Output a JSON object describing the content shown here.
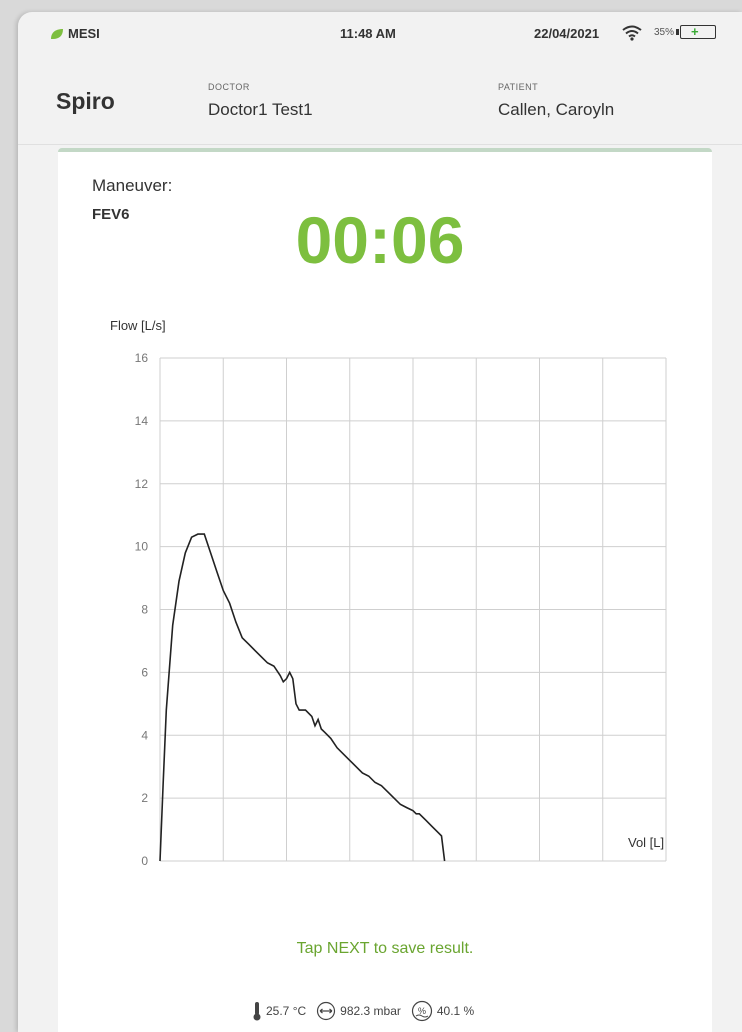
{
  "status_bar": {
    "brand": "MESI",
    "time": "11:48 AM",
    "date": "22/04/2021",
    "battery": "35%",
    "brand_color": "#7dbf3f"
  },
  "header": {
    "title": "Spiro",
    "doctor_label": "DOCTOR",
    "doctor_name": "Doctor1 Test1",
    "patient_label": "PATIENT",
    "patient_name": "Callen, Caroyln"
  },
  "maneuver": {
    "label": "Maneuver:",
    "value": "FEV6"
  },
  "timer": "00:06",
  "timer_color": "#7dbf3f",
  "chart_data": {
    "type": "line",
    "ylabel": "Flow [L/s]",
    "xlabel": "Vol [L]",
    "xlim": [
      0,
      8
    ],
    "ylim": [
      0,
      16
    ],
    "xticks": [
      "0",
      "1",
      "2",
      "3",
      "4",
      "5",
      "6",
      "7",
      "8"
    ],
    "yticks": [
      "0",
      "2",
      "4",
      "6",
      "8",
      "10",
      "12",
      "14",
      "16"
    ],
    "grid": true,
    "series": [
      {
        "x": [
          0.0,
          0.05,
          0.1,
          0.2,
          0.3,
          0.4,
          0.5,
          0.6,
          0.7,
          0.8,
          0.9,
          1.0,
          1.1,
          1.2,
          1.3,
          1.4,
          1.5,
          1.6,
          1.7,
          1.8,
          1.9,
          1.95,
          2.0,
          2.05,
          2.1,
          2.15,
          2.2,
          2.3,
          2.4,
          2.45,
          2.5,
          2.55,
          2.6,
          2.7,
          2.8,
          2.9,
          3.0,
          3.1,
          3.2,
          3.3,
          3.4,
          3.5,
          3.6,
          3.7,
          3.8,
          3.9,
          4.0,
          4.05,
          4.1,
          4.2,
          4.3,
          4.4,
          4.45,
          4.5
        ],
        "y": [
          0.0,
          2.5,
          4.8,
          7.5,
          8.9,
          9.8,
          10.3,
          10.4,
          10.4,
          9.8,
          9.2,
          8.6,
          8.2,
          7.6,
          7.1,
          6.9,
          6.7,
          6.5,
          6.3,
          6.2,
          5.9,
          5.7,
          5.8,
          6.0,
          5.8,
          5.0,
          4.8,
          4.8,
          4.6,
          4.3,
          4.5,
          4.2,
          4.1,
          3.9,
          3.6,
          3.4,
          3.2,
          3.0,
          2.8,
          2.7,
          2.5,
          2.4,
          2.2,
          2.0,
          1.8,
          1.7,
          1.6,
          1.5,
          1.5,
          1.3,
          1.1,
          0.9,
          0.8,
          0.0
        ]
      }
    ]
  },
  "hint": "Tap NEXT to save result.",
  "environment": {
    "temperature": "25.7 °C",
    "pressure": "982.3 mbar",
    "humidity": "40.1 %"
  },
  "icons": [
    "leaf-icon",
    "wifi-icon",
    "battery-icon",
    "thermometer-icon",
    "pressure-icon",
    "humidity-icon"
  ]
}
